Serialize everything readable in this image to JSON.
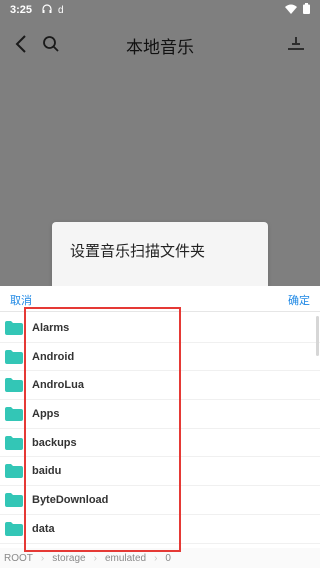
{
  "status_bar": {
    "time": "3:25",
    "headset_icon": "headset-icon",
    "tiktok_icon": "d"
  },
  "toolbar": {
    "title": "本地音乐"
  },
  "background_dialog": {
    "title": "设置音乐扫描文件夹"
  },
  "picker": {
    "cancel_label": "取消",
    "confirm_label": "确定",
    "folders": [
      {
        "name": "Alarms"
      },
      {
        "name": "Android"
      },
      {
        "name": "AndroLua"
      },
      {
        "name": "Apps"
      },
      {
        "name": "backups"
      },
      {
        "name": "baidu"
      },
      {
        "name": "ByteDownload"
      },
      {
        "name": "data"
      }
    ],
    "breadcrumb": [
      "ROOT",
      "storage",
      "emulated",
      "0"
    ]
  },
  "colors": {
    "accent": "#1e88e5",
    "folder": "#33c6b6",
    "highlight": "#e53935"
  }
}
